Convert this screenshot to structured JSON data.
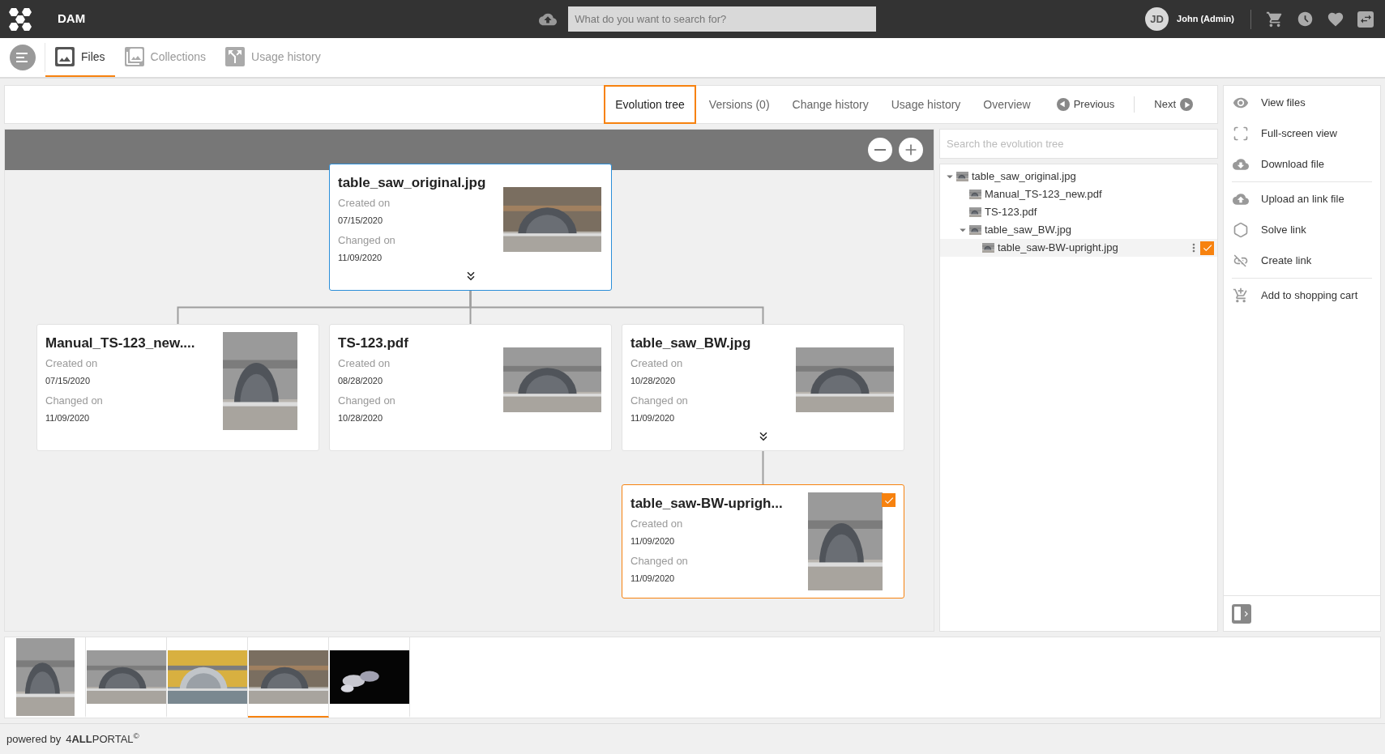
{
  "header": {
    "app_name": "DAM",
    "search": {
      "placeholder": "What do you want to search for?"
    },
    "user": {
      "initials": "JD",
      "name": "John (Admin)"
    }
  },
  "nav_tabs": [
    {
      "label": "Files",
      "selected": true
    },
    {
      "label": "Collections",
      "selected": false
    },
    {
      "label": "Usage history",
      "selected": false
    }
  ],
  "detail_tabs": [
    {
      "label": "Evolution tree",
      "selected": true
    },
    {
      "label": "Versions (0)",
      "selected": false
    },
    {
      "label": "Change history",
      "selected": false
    },
    {
      "label": "Usage history",
      "selected": false
    },
    {
      "label": "Overview",
      "selected": false
    }
  ],
  "pager": {
    "previous": "Previous",
    "next": "Next"
  },
  "evolution_tree": {
    "name": "table_saw_original.jpg",
    "created_label": "Created on",
    "created": "07/15/2020",
    "changed_label": "Changed on",
    "changed": "11/09/2020",
    "kind": "landscape",
    "active": true,
    "selected": false,
    "expanded": true,
    "children": [
      {
        "name": "Manual_TS-123_new....",
        "created_label": "Created on",
        "created": "07/15/2020",
        "changed_label": "Changed on",
        "changed": "11/09/2020",
        "kind": "portrait",
        "active": false,
        "selected": false,
        "expanded": false
      },
      {
        "name": "TS-123.pdf",
        "created_label": "Created on",
        "created": "08/28/2020",
        "changed_label": "Changed on",
        "changed": "10/28/2020",
        "kind": "landscape",
        "active": false,
        "selected": false,
        "expanded": false
      },
      {
        "name": "table_saw_BW.jpg",
        "created_label": "Created on",
        "created": "10/28/2020",
        "changed_label": "Changed on",
        "changed": "11/09/2020",
        "kind": "landscape",
        "active": false,
        "selected": false,
        "expanded": true,
        "children": [
          {
            "name": "table_saw-BW-uprigh...",
            "created_label": "Created on",
            "created": "11/09/2020",
            "changed_label": "Changed on",
            "changed": "11/09/2020",
            "kind": "portrait",
            "active": false,
            "selected": true,
            "expanded": false
          }
        ]
      }
    ]
  },
  "tree_search": {
    "placeholder": "Search the evolution tree"
  },
  "tree_list": [
    {
      "name": "table_saw_original.jpg",
      "expanded": true,
      "selected": false,
      "children": [
        {
          "name": "Manual_TS-123_new.pdf",
          "selected": false
        },
        {
          "name": "TS-123.pdf",
          "selected": false
        },
        {
          "name": "table_saw_BW.jpg",
          "expanded": true,
          "selected": false,
          "children": [
            {
              "name": "table_saw-BW-upright.jpg",
              "selected": true
            }
          ]
        }
      ]
    }
  ],
  "actions": [
    [
      {
        "label": "View files"
      },
      {
        "label": "Full-screen view"
      },
      {
        "label": "Download file"
      }
    ],
    [
      {
        "label": "Upload an link file"
      },
      {
        "label": "Solve link"
      },
      {
        "label": "Create link"
      }
    ],
    [
      {
        "label": "Add to shopping cart"
      }
    ]
  ],
  "filmstrip": [
    {
      "kind": "picture",
      "selected": false
    },
    {
      "kind": "picture",
      "selected": false
    },
    {
      "kind": "picture",
      "selected": false
    },
    {
      "kind": "picture",
      "selected": true
    },
    {
      "kind": "picture",
      "selected": false
    }
  ],
  "footer": {
    "powered_by": "powered by",
    "brand": "4**ALL**PORTAL$^{©}$"
  }
}
